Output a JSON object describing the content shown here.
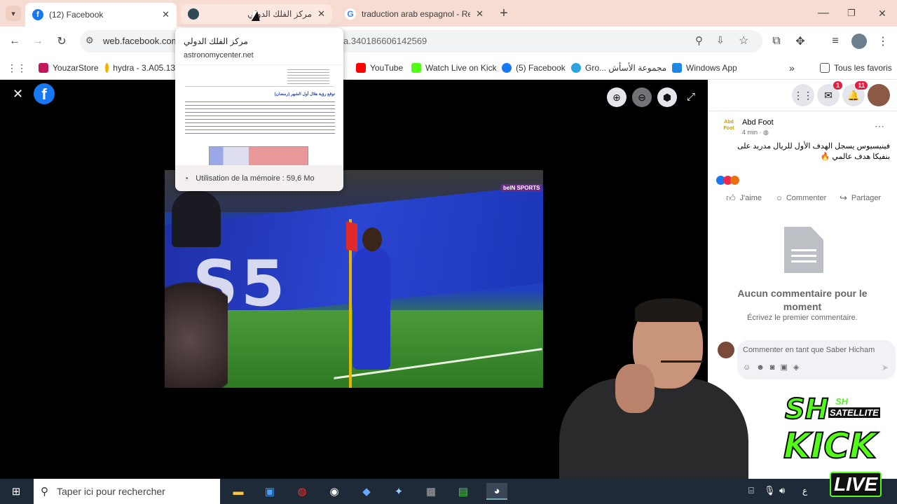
{
  "browser": {
    "tab_list_icon": "chevron-down-icon",
    "tabs": [
      {
        "title": "(12) Facebook",
        "favicon": "facebook-icon",
        "favicon_color": "#1877f2",
        "active": true
      },
      {
        "title": "مركز الفلك الدولي",
        "favicon": "globe-icon",
        "favicon_color": "#2e4a55",
        "active": false
      },
      {
        "title": "traduction arab espagnol - Rec",
        "favicon": "google-icon",
        "favicon_color": "#4285f4",
        "active": false
      }
    ],
    "new_tab_label": "+",
    "window_controls": [
      "—",
      "❐",
      "✕"
    ],
    "url": "web.facebook.com",
    "url_tail": "a.340186606142569",
    "bookmarks": [
      {
        "label": "YouzarStore",
        "icon_color": "#c2185b"
      },
      {
        "label": "hydra - 3.A05.13",
        "icon_color": "#f0b400"
      },
      {
        "label": "YouTube",
        "icon_color": "#ff0000"
      },
      {
        "label": "Watch Live on Kick",
        "icon_color": "#53fc18"
      },
      {
        "label": "(5) Facebook",
        "icon_color": "#1877f2"
      },
      {
        "label": "Gro... مجموعة الأسأش",
        "icon_color": "#2aa3e0"
      },
      {
        "label": "Windows App",
        "icon_color": "#1e88e5"
      }
    ],
    "bookmarks_overflow": "»",
    "all_bookmarks_label": "Tous les favoris"
  },
  "tab_hover_card": {
    "title": "مركز الفلك الدولي",
    "domain": "astronomycenter.net",
    "preview_heading": "توقع رؤية هلال أول الشهر (رمضان)",
    "memory_label": "Utilisation de la mémoire : 59,6 Mo"
  },
  "viewer": {
    "close_symbol": "✕",
    "video_overlay_text": "beIN SPORTS",
    "board_text": "S5",
    "zoom_in": "+",
    "zoom_out": "−"
  },
  "facebook_panel": {
    "notifications_count": "11",
    "messenger_count": "1",
    "post": {
      "author": "Abd Foot",
      "avatar_text": "Abd Foot",
      "time": "4 min ·",
      "text": "فينيسيوس يسجل الهدف الأول للريال مدريد على بنفيكا هدف عالمي 🔥"
    },
    "actions": [
      "J'aime",
      "Commenter",
      "Partager"
    ],
    "empty_title": "Aucun commentaire pour le moment",
    "empty_subtitle": "Écrivez le premier commentaire.",
    "comment_placeholder": "Commenter en tant que Saber Hicham"
  },
  "taskbar": {
    "search_placeholder": "Taper ici pour rechercher",
    "tray_text": "ع"
  },
  "overlay": {
    "sh_text": "SH",
    "sh_small": "SH",
    "satellite": "SATELLITE",
    "kick": "KICK",
    "live": "LIVE"
  }
}
